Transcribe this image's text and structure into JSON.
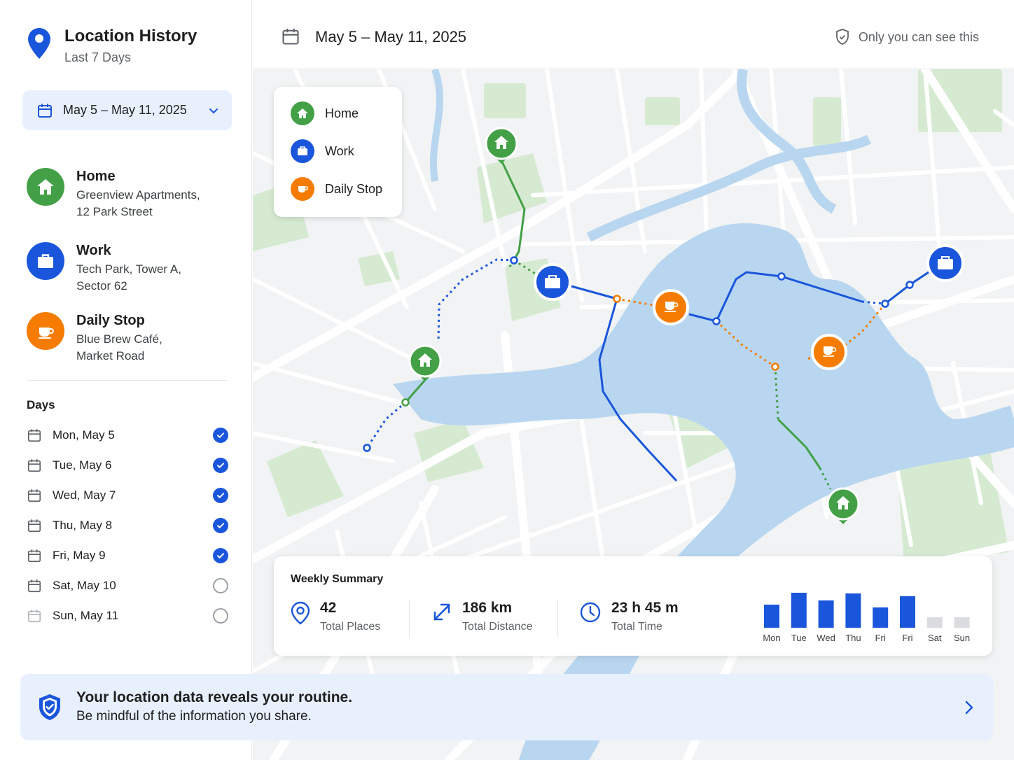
{
  "app": {
    "title": "Location History",
    "subtitle": "Last 7 Days"
  },
  "date_range": {
    "label": "May 5 – May 11, 2025"
  },
  "header": {
    "date": "May 5 – May 11, 2025",
    "privacy": "Only you can see this"
  },
  "places": [
    {
      "name": "Home",
      "address1": "Greenview Apartments,",
      "address2": "12 Park Street",
      "icon": "home-icon",
      "color": "#43a047"
    },
    {
      "name": "Work",
      "address1": "Tech Park, Tower A,",
      "address2": "Sector 62",
      "icon": "briefcase-icon",
      "color": "#1a56db"
    },
    {
      "name": "Daily Stop",
      "address1": "Blue Brew Café,",
      "address2": "Market Road",
      "icon": "coffee-cup-icon",
      "color": "#f57c00"
    }
  ],
  "days": {
    "heading": "Days",
    "items": [
      {
        "label": "Mon, May 5",
        "checked": true
      },
      {
        "label": "Tue, May 6",
        "checked": true
      },
      {
        "label": "Wed, May 7",
        "checked": true
      },
      {
        "label": "Thu, May 8",
        "checked": true
      },
      {
        "label": "Fri, May 9",
        "checked": true
      },
      {
        "label": "Sat, May 10",
        "checked": false
      },
      {
        "label": "Sun, May 11",
        "checked": false
      }
    ]
  },
  "legend": [
    {
      "label": "Home",
      "color": "#43a047"
    },
    {
      "label": "Work",
      "color": "#1a56db"
    },
    {
      "label": "Daily Stop",
      "color": "#f57c00"
    }
  ],
  "summary": {
    "title": "Weekly Summary",
    "places_value": "42",
    "places_label": "Total Places",
    "distance_value": "186 km",
    "distance_label": "Total Distance",
    "time_value": "23 h 45 m",
    "time_label": "Total Time"
  },
  "chart_data": {
    "type": "bar",
    "categories": [
      "Mon",
      "Tue",
      "Wed",
      "Thu",
      "Fri",
      "Fri",
      "Sat",
      "Sun"
    ],
    "values": [
      0.66,
      1.0,
      0.78,
      0.98,
      0.58,
      0.9,
      0.3,
      0.3
    ],
    "colors": [
      "#1a56db",
      "#1a56db",
      "#1a56db",
      "#1a56db",
      "#1a56db",
      "#1a56db",
      "#dadce0",
      "#dadce0"
    ],
    "ylim": [
      0,
      1
    ]
  },
  "banner": {
    "title": "Your location data reveals your routine.",
    "text": "Be mindful of the information you share."
  }
}
